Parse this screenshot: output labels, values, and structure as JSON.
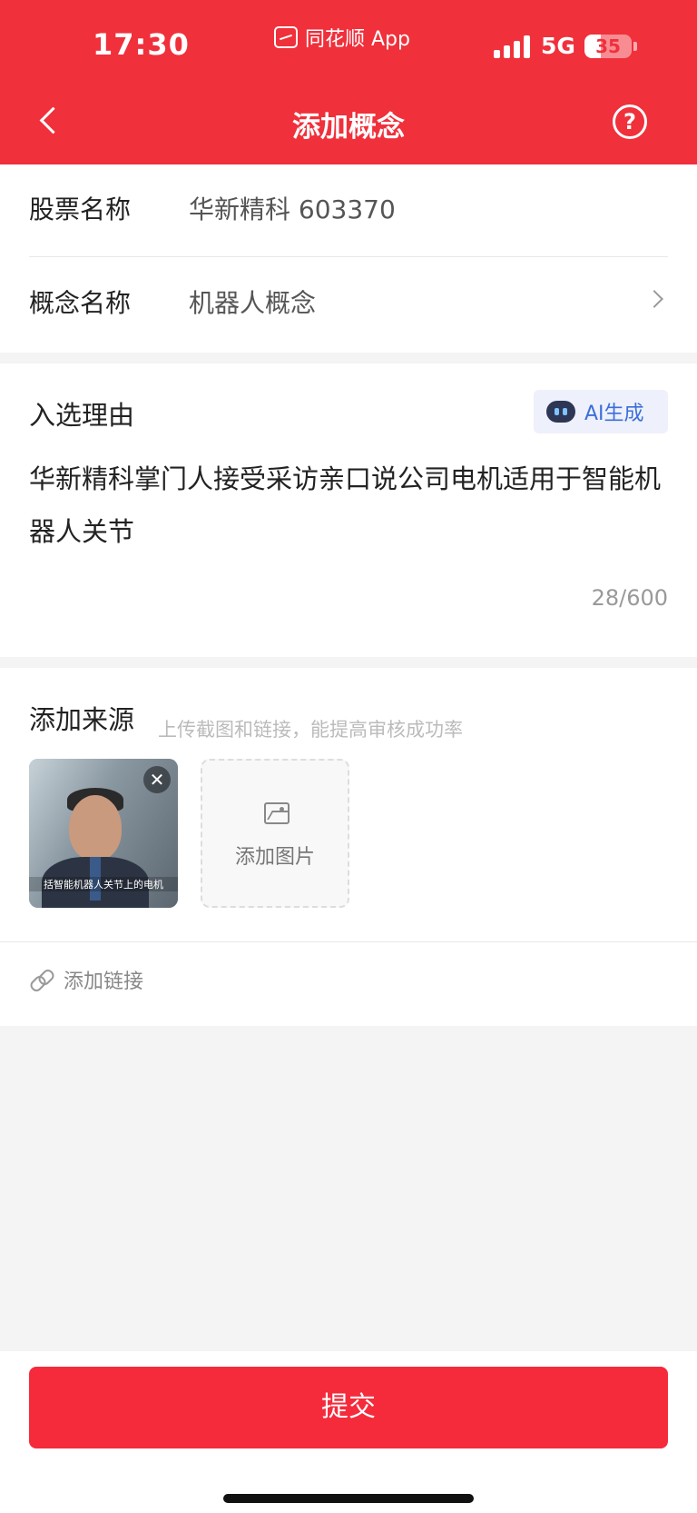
{
  "status_bar": {
    "time": "17:30",
    "app_name": "同花顺 App",
    "network": "5G",
    "battery": "35",
    "battery_level": 0.35
  },
  "header": {
    "title": "添加概念",
    "back_icon": "chevron-left-icon",
    "help_icon": "question-icon",
    "help_symbol": "?"
  },
  "stock_info": {
    "stock_label": "股票名称",
    "stock_value": "华新精科 603370",
    "concept_label": "概念名称",
    "concept_value": "机器人概念"
  },
  "reason": {
    "title": "入选理由",
    "ai_button_label": "AI生成",
    "text": "华新精科掌门人接受采访亲口说公司电机适用于智能机器人关节",
    "counter": "28/600"
  },
  "source": {
    "title": "添加来源",
    "hint": "上传截图和链接，能提高审核成功率",
    "image_caption": "括智能机器人关节上的电机",
    "close_symbol": "✕",
    "add_image_label": "添加图片",
    "add_link_label": "添加链接"
  },
  "footer": {
    "submit_label": "提交"
  },
  "colors": {
    "brand_red": "#f0303b",
    "submit_red": "#f52b3b",
    "ai_blue": "#3b6fd8"
  }
}
